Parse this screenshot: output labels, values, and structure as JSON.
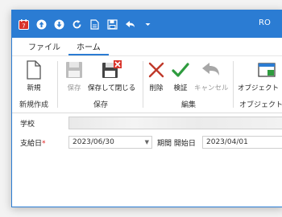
{
  "window": {
    "title": "RO"
  },
  "quick_access": [
    {
      "name": "app-icon"
    },
    {
      "name": "upload-icon"
    },
    {
      "name": "download-icon"
    },
    {
      "name": "refresh-icon"
    },
    {
      "name": "document-icon"
    },
    {
      "name": "save-form-icon"
    },
    {
      "name": "undo-icon"
    },
    {
      "name": "dropdown-icon"
    }
  ],
  "tabs": [
    {
      "label": "ファイル",
      "active": false
    },
    {
      "label": "ホーム",
      "active": true
    }
  ],
  "ribbon": {
    "groups": {
      "new": {
        "label": "新規作成"
      },
      "save": {
        "label": "保存"
      },
      "edit": {
        "label": "編集"
      },
      "object": {
        "label": "オブジェクト"
      }
    },
    "buttons": {
      "new": {
        "label": "新規"
      },
      "save": {
        "label": "保存"
      },
      "save_close": {
        "label": "保存して閉じる"
      },
      "delete": {
        "label": "削除"
      },
      "validate": {
        "label": "検証"
      },
      "cancel": {
        "label": "キャンセル"
      },
      "object": {
        "label": "オブジェクト"
      }
    }
  },
  "form": {
    "school_label": "学校",
    "pay_date_label": "支給日",
    "required_mark": "*",
    "pay_date_value": "2023/06/30",
    "period_start_label": "期間 開始日",
    "period_start_value": "2023/04/01"
  },
  "colors": {
    "accent": "#2b7cd3",
    "delete": "#c0392b",
    "validate": "#2e9b3e"
  }
}
